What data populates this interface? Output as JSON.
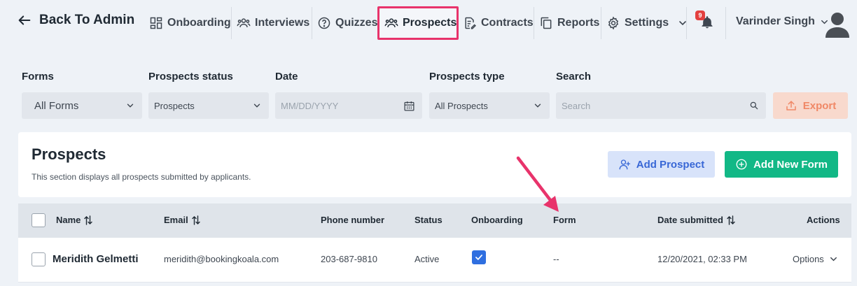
{
  "nav": {
    "back_label": "Back To Admin",
    "items": [
      {
        "label": "Onboarding",
        "icon": "grid-icon"
      },
      {
        "label": "Interviews",
        "icon": "people-icon"
      },
      {
        "label": "Quizzes",
        "icon": "question-circle-icon"
      },
      {
        "label": "Prospects",
        "icon": "people-icon",
        "active": true
      },
      {
        "label": "Contracts",
        "icon": "document-edit-icon"
      },
      {
        "label": "Reports",
        "icon": "copy-icon"
      },
      {
        "label": "Settings",
        "icon": "gear-icon"
      }
    ],
    "notification_count": "9",
    "user_name": "Varinder Singh"
  },
  "filters": {
    "forms": {
      "label": "Forms",
      "value": "All Forms"
    },
    "status": {
      "label": "Prospects status",
      "value": "Prospects"
    },
    "date": {
      "label": "Date",
      "placeholder": "MM/DD/YYYY"
    },
    "type": {
      "label": "Prospects type",
      "value": "All Prospects"
    },
    "search": {
      "label": "Search",
      "placeholder": "Search"
    },
    "export_label": "Export"
  },
  "section": {
    "title": "Prospects",
    "subtitle": "This section displays all prospects submitted by applicants.",
    "add_prospect_label": "Add Prospect",
    "add_form_label": "Add New Form"
  },
  "table": {
    "columns": [
      "Name",
      "Email",
      "Phone number",
      "Status",
      "Onboarding",
      "Form",
      "Date submitted",
      "Actions"
    ],
    "rows": [
      {
        "name": "Meridith Gelmetti",
        "email": "meridith@bookingkoala.com",
        "phone": "203-687-9810",
        "status": "Active",
        "onboarding": true,
        "form": "--",
        "date": "12/20/2021, 02:33 PM",
        "actions": "Options"
      }
    ]
  },
  "colors": {
    "highlight": "#e8336b",
    "primary_green": "#12b886",
    "primary_blue": "#3867d6",
    "export_orange": "#f08866"
  }
}
